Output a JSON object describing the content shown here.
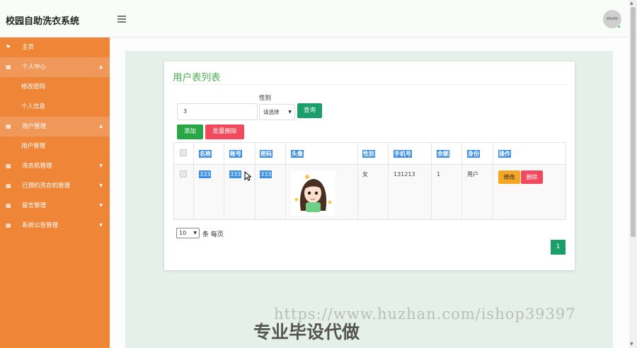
{
  "app": {
    "title": "校园自助洗衣系统",
    "avatar_text": "80x80"
  },
  "sidebar": {
    "items": [
      {
        "label": "主页",
        "icon": "flag-icon"
      },
      {
        "label": "个人中心",
        "icon": "grid-icon",
        "expanded": true,
        "children": [
          "修改密码",
          "个人信息"
        ]
      },
      {
        "label": "用户管理",
        "icon": "grid-icon",
        "expanded": true,
        "children": [
          "用户管理"
        ]
      },
      {
        "label": "洗衣机管理",
        "icon": "grid-icon"
      },
      {
        "label": "已预约洗衣机管理",
        "icon": "grid-icon"
      },
      {
        "label": "留言管理",
        "icon": "grid-icon"
      },
      {
        "label": "系统公告管理",
        "icon": "grid-icon"
      }
    ]
  },
  "page": {
    "title": "用户表列表",
    "search": {
      "value": "3"
    },
    "gender": {
      "label": "性别",
      "selected": "请选择"
    },
    "buttons": {
      "query": "查询",
      "add": "添加",
      "batch_delete": "批量删除"
    }
  },
  "table": {
    "columns": [
      "名称",
      "账号",
      "密码",
      "头像",
      "性别",
      "手机号",
      "余额",
      "身份",
      "操作"
    ],
    "rows": [
      {
        "name": "333",
        "account": "333",
        "password": "333",
        "gender": "女",
        "phone": "131213",
        "balance": "1",
        "role": "用户",
        "edit": "修改",
        "delete": "删除"
      }
    ]
  },
  "pagination": {
    "page_size": "10",
    "per_page_text": "条 每页",
    "current_page": "1"
  },
  "watermark": {
    "url": "https://www.huzhan.com/ishop39397",
    "text": "专业毕设代做"
  }
}
